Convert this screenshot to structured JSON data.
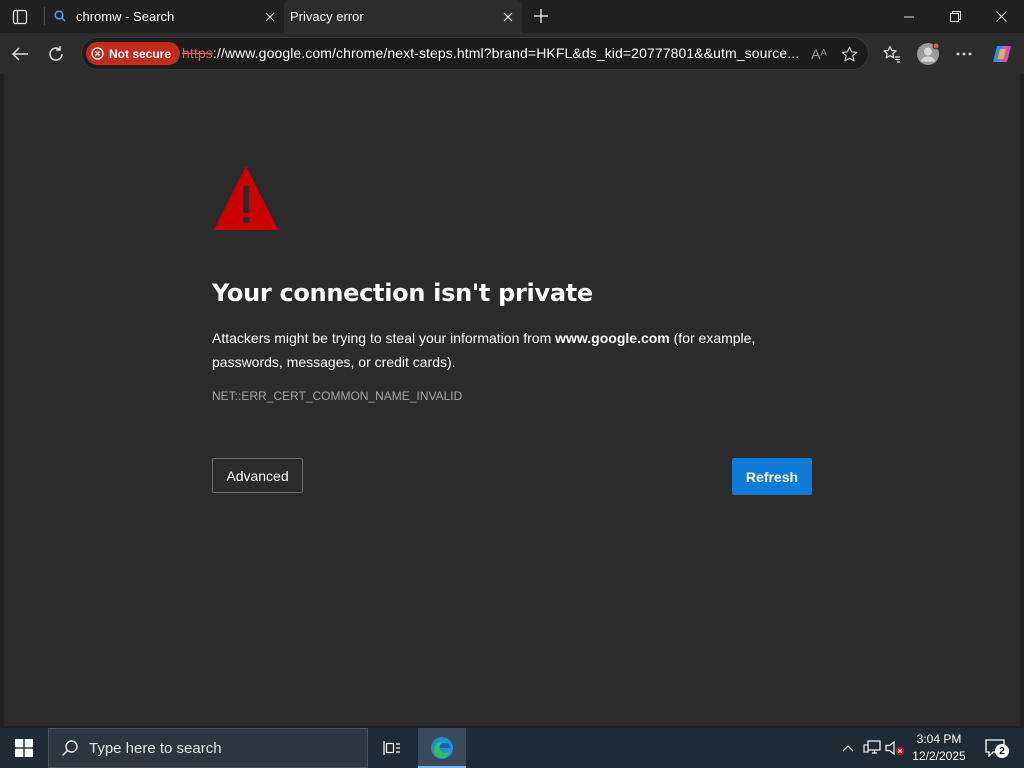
{
  "tabs": [
    {
      "label": "chromw - Search",
      "icon": "search-icon"
    },
    {
      "label": "Privacy error",
      "icon": "none"
    }
  ],
  "address_bar": {
    "security_label": "Not secure",
    "url_scheme": "https",
    "url_rest": "://www.google.com/chrome/next-steps.html?brand=HKFL&ds_kid=20777801&&utm_source...",
    "read_aloud_glyph": "Aᴬ"
  },
  "page": {
    "title": "Your connection isn't private",
    "description_before": "Attackers might be trying to steal your information from ",
    "description_host": "www.google.com",
    "description_after": " (for example, passwords, messages, or credit cards).",
    "error_code": "NET::ERR_CERT_COMMON_NAME_INVALID",
    "advanced_label": "Advanced",
    "refresh_label": "Refresh"
  },
  "taskbar": {
    "search_placeholder": "Type here to search",
    "time": "3:04 PM",
    "date": "12/2/2025",
    "notification_count": "2"
  },
  "colors": {
    "not_secure": "#c42b1c",
    "warning": "#cc0000",
    "refresh_button": "#0f7bd9",
    "content_bg": "#2b2b2b"
  }
}
